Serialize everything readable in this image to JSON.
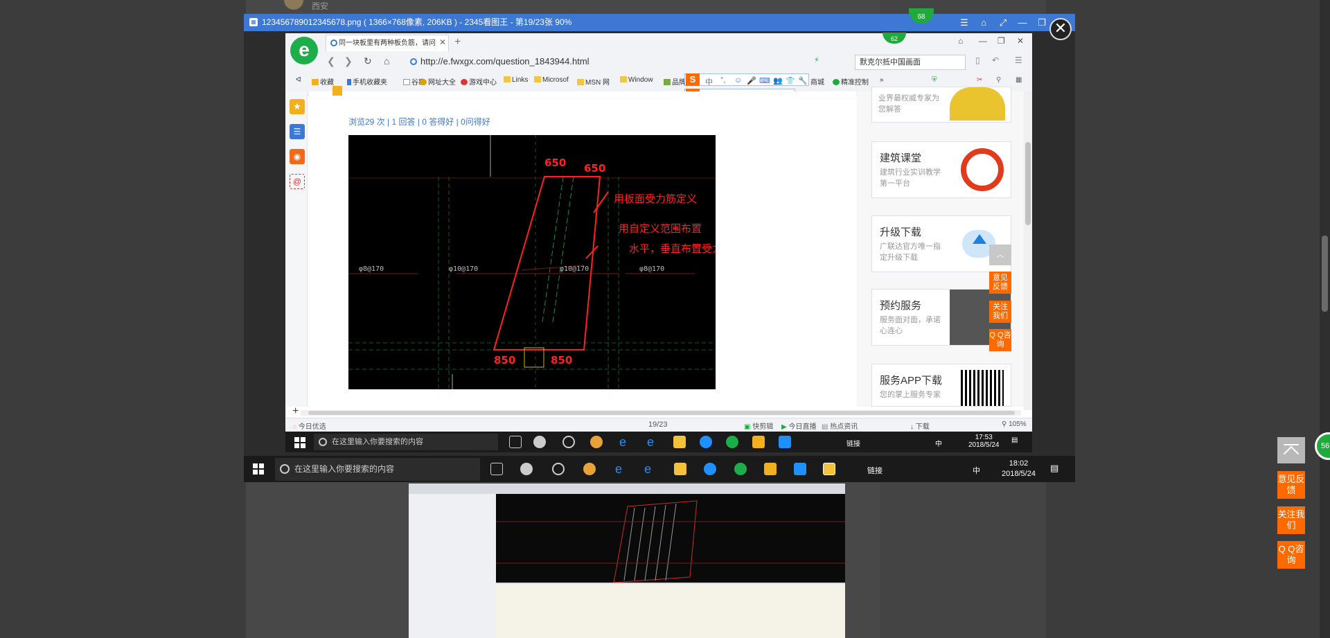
{
  "background": {
    "city": "西安"
  },
  "viewer": {
    "title": "123456789012345678.png ( 1366×768像素, 206KB ) - 2345看图王 - 第19/23张 90%",
    "badge_top": "68",
    "close": "✕"
  },
  "browser": {
    "tab_title": "同一块板里有两种板负筋，请问",
    "badge": "62",
    "url": "http://e.fwxgx.com/question_1843944.html",
    "search_text": "默克尔抵中国画面",
    "bookmarks": [
      "收藏",
      "手机收藏夹",
      "谷歌",
      "网址大全",
      "游戏中心",
      "Links",
      "Microsof",
      "MSN 网",
      "Window",
      "品牌",
      "商城",
      "精准控制"
    ],
    "sogou_items": [
      "中",
      "°,",
      "☺",
      "🎤",
      "⌨",
      "👥",
      "👕",
      "🔧"
    ]
  },
  "question": {
    "title": "同一块板里有两种板负筋，请问这种情况怎么布置？",
    "stats": "浏览29 次 | 1 回答 | 0 答得好 | 0问得好"
  },
  "cad": {
    "dim_top_left": "650",
    "dim_top_right": "650",
    "dim_bottom_left": "850",
    "dim_bottom_right": "850",
    "note1": "用板面受力筋定义",
    "note2": "用自定义范围布置",
    "note3": "水平，垂直布置受力钢筋和分布钢筋",
    "rebar1": "φ8@170",
    "rebar2": "φ10@170",
    "rebar3": "φ10@170",
    "rebar4": "φ8@170"
  },
  "right_cards": [
    {
      "title": "",
      "sub": "业界最权威专家为您解答"
    },
    {
      "title": "建筑课堂",
      "sub": "建筑行业实训教学第一平台"
    },
    {
      "title": "升级下载",
      "sub": "广联达官方唯一指定升级下载"
    },
    {
      "title": "预约服务",
      "sub": "服务面对面，承诺心连心"
    },
    {
      "title": "服务APP下载",
      "sub": "您的掌上服务专家"
    }
  ],
  "right_side_buttons": [
    "意见反馈",
    "关注我们",
    "Q Q咨询"
  ],
  "status_bar": {
    "left": "今日优选",
    "page": "19/23",
    "items": [
      "快剪辑",
      "今日直播",
      "热点资讯",
      "下载"
    ],
    "zoom": "105%"
  },
  "inner_taskbar": {
    "search_placeholder": "在这里输入你要搜索的内容",
    "links": "链接",
    "ime": "中",
    "time": "17:53",
    "date": "2018/5/24",
    "notif": "1"
  },
  "outer_taskbar": {
    "search_placeholder": "在这里输入你要搜索的内容",
    "links": "链接",
    "ime": "中",
    "time": "18:02",
    "date": "2018/5/24",
    "notif": "1"
  },
  "float_buttons": [
    "意见反馈",
    "关注我们",
    "Q Q咨询"
  ],
  "float_badge": "56"
}
